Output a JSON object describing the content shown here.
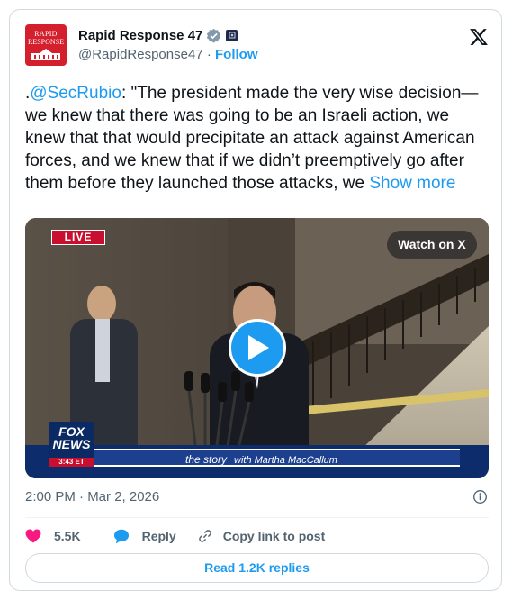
{
  "author": {
    "name": "Rapid Response 47",
    "handle": "@RapidResponse47",
    "separator": "·",
    "follow_label": "Follow",
    "avatar_text_line1": "RAPID",
    "avatar_text_line2": "RESPONSE"
  },
  "post": {
    "text_prefix": ".",
    "mention": "@SecRubio",
    "text_body": ": \"The president made the very wise decision—we knew that there was going to be an Israeli action, we knew that that would precipitate an attack against American forces, and we knew that if we didn’t preemptively go after them before they launched those attacks, we ",
    "show_more_label": "Show more"
  },
  "media": {
    "live_label": "LIVE",
    "watch_label": "Watch on X",
    "network_line1": "FOX",
    "network_line2": "NEWS",
    "network_time": "3:43 ET",
    "story_title": "the story",
    "story_host": "with Martha MacCallum"
  },
  "meta": {
    "timestamp": "2:00 PM · Mar 2, 2026"
  },
  "actions": {
    "likes": "5.5K",
    "reply_label": "Reply",
    "copy_label": "Copy link to post"
  },
  "read_replies_label": "Read 1.2K replies",
  "colors": {
    "accent": "#1d9bf0",
    "like": "#f91880",
    "avatar_bg": "#d4202c"
  }
}
